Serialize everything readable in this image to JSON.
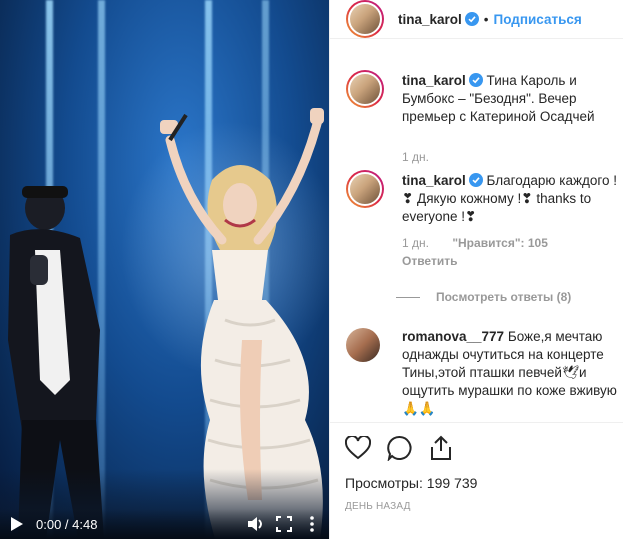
{
  "video": {
    "time_display": "0:00 / 4:48",
    "icons": [
      "play-icon",
      "volume-icon",
      "fullscreen-icon",
      "more-vertical-icon"
    ]
  },
  "header": {
    "username": "tina_karol",
    "separator": "•",
    "follow_label": "Подписаться"
  },
  "comments": [
    {
      "username": "tina_karol",
      "text": "Тина Кароль и Бумбокс – \"Безодня\". Вечер премьер с Катериной Осадчей",
      "time": "1 дн."
    },
    {
      "username": "tina_karol",
      "text": "Благодарю каждого ! ❣ Дякую кожному !❣ thanks to everyone !❣",
      "time": "1 дн.",
      "likes": "\"Нравится\": 105",
      "reply_label": "Ответить"
    },
    {
      "username": "romanova__777",
      "text": "Боже,я мечтаю однажды очутиться на концерте Тины,этой пташки певчей🕊и ощутить мурашки по коже вживую🙏🙏"
    }
  ],
  "view_replies_label": "Посмотреть ответы (8)",
  "actions": {
    "icons": [
      "heart-icon",
      "comment-icon",
      "share-icon"
    ],
    "views_label": "Просмотры:",
    "views_count": "199 739",
    "date": "ДЕНЬ НАЗАД"
  },
  "colors": {
    "link_blue": "#3897f0",
    "verified_blue": "#3897f0",
    "muted_text": "#999999"
  }
}
